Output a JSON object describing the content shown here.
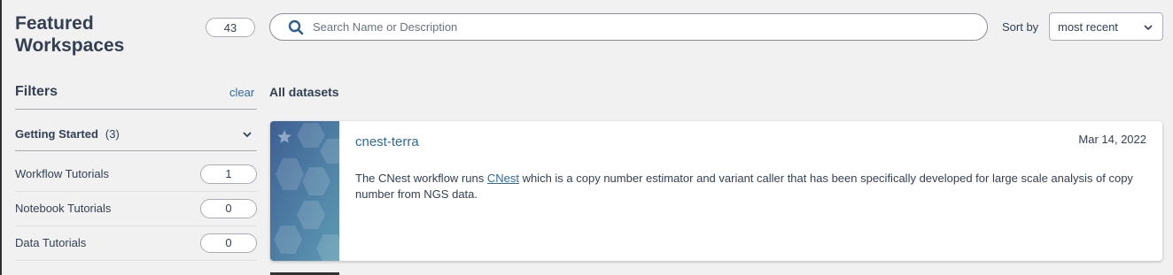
{
  "header": {
    "title_line1": "Featured",
    "title_line2": "Workspaces",
    "count": "43",
    "search_placeholder": "Search Name or Description",
    "sort_label": "Sort by",
    "sort_value": "most recent"
  },
  "filters": {
    "title": "Filters",
    "clear_label": "clear",
    "group": {
      "name": "Getting Started",
      "count": "(3)"
    },
    "items": [
      {
        "label": "Workflow Tutorials",
        "count": "1"
      },
      {
        "label": "Notebook Tutorials",
        "count": "0"
      },
      {
        "label": "Data Tutorials",
        "count": "0"
      }
    ]
  },
  "main": {
    "section_title": "All datasets",
    "cards": [
      {
        "title": "cnest-terra",
        "date": "Mar 14, 2022",
        "desc_before": "The CNest workflow runs ",
        "desc_link": "CNest",
        "desc_after": " which is a copy number estimator and variant caller that has been specifically developed for large scale analysis of copy number from NGS data."
      }
    ]
  },
  "colors": {
    "accent": "#2f6a9e",
    "text": "#333f52",
    "background": "#f1f1f2",
    "thumb_dark": "#3d5f93",
    "thumb_light": "#5e9bb4"
  },
  "icons": {
    "search": "search-icon",
    "sort_chevron": "chevron-down-icon",
    "group_chevron": "chevron-down-icon",
    "favorite": "star-icon"
  }
}
